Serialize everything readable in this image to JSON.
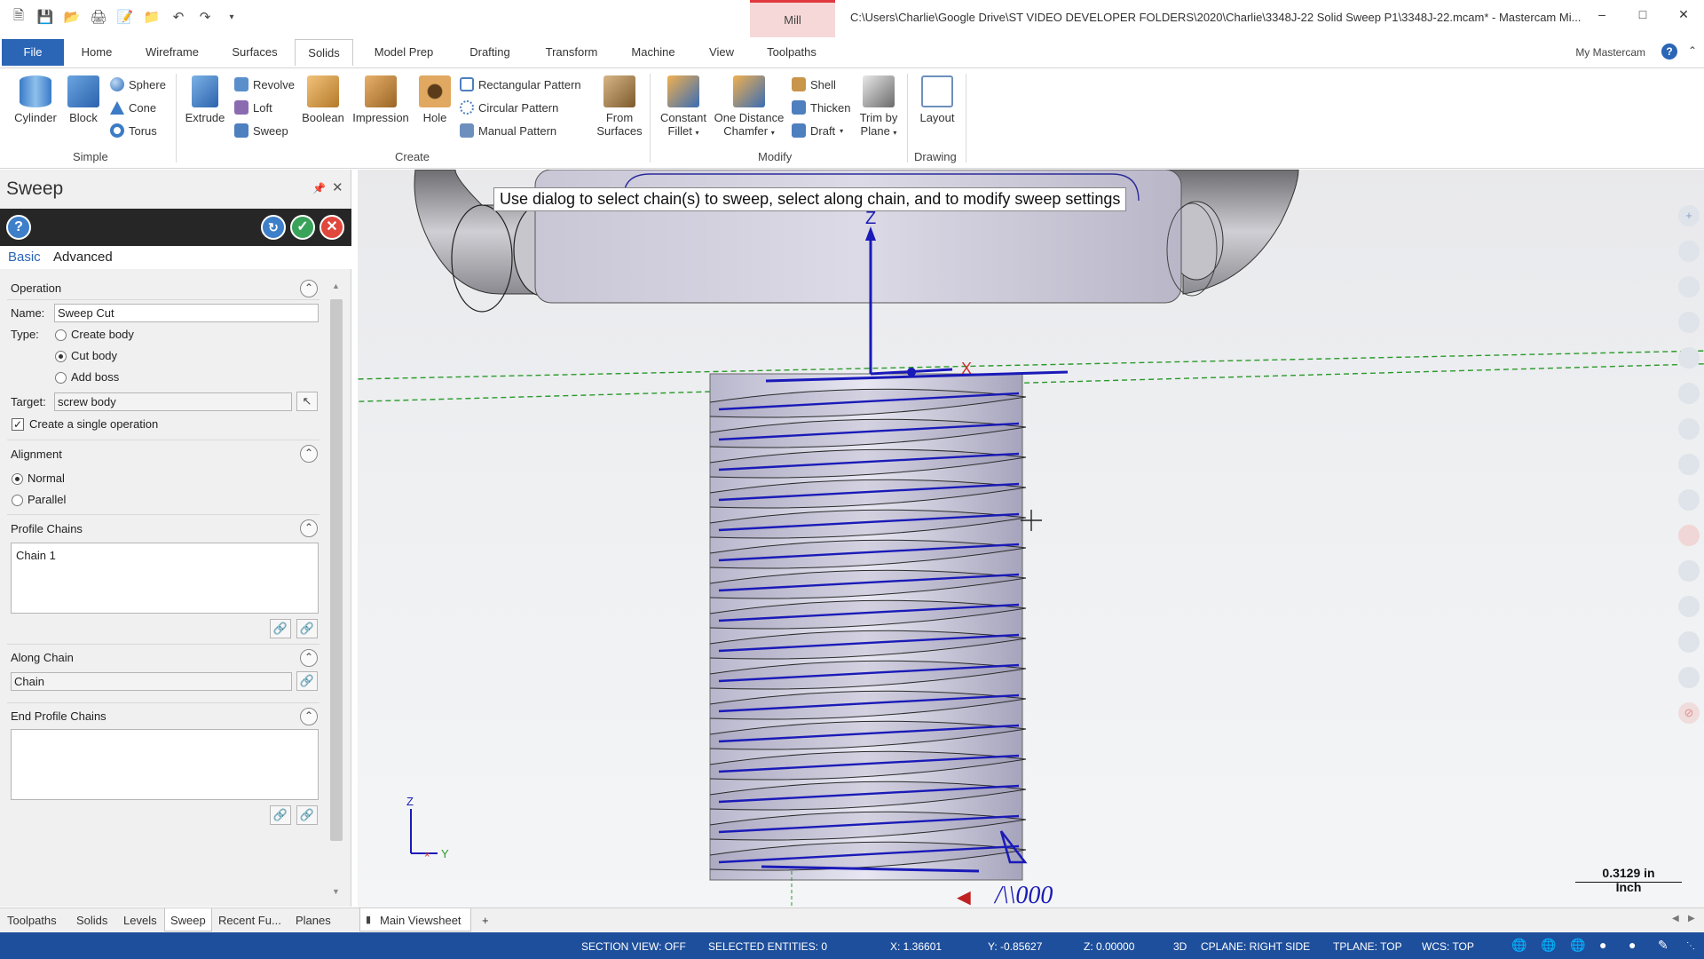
{
  "app": {
    "title": "C:\\Users\\Charlie\\Google Drive\\ST VIDEO DEVELOPER FOLDERS\\2020\\Charlie\\3348J-22 Solid Sweep P1\\3348J-22.mcam* - Mastercam Mi...",
    "context_tab": "Mill",
    "my_mastercam": "My Mastercam"
  },
  "ribbon_tabs": [
    "File",
    "Home",
    "Wireframe",
    "Surfaces",
    "Solids",
    "Model Prep",
    "Drafting",
    "Transform",
    "Machine",
    "View",
    "Toolpaths"
  ],
  "ribbon": {
    "simple": {
      "label": "Simple",
      "cylinder": "Cylinder",
      "block": "Block",
      "sphere": "Sphere",
      "cone": "Cone",
      "torus": "Torus"
    },
    "create": {
      "label": "Create",
      "extrude": "Extrude",
      "revolve": "Revolve",
      "loft": "Loft",
      "sweep": "Sweep",
      "boolean": "Boolean",
      "impression": "Impression",
      "hole": "Hole",
      "rect_pattern": "Rectangular Pattern",
      "circ_pattern": "Circular Pattern",
      "manual_pattern": "Manual Pattern",
      "from_surfaces_1": "From",
      "from_surfaces_2": "Surfaces"
    },
    "modify": {
      "label": "Modify",
      "const_fillet_1": "Constant",
      "const_fillet_2": "Fillet",
      "chamfer_1": "One Distance",
      "chamfer_2": "Chamfer",
      "shell": "Shell",
      "thicken": "Thicken",
      "draft": "Draft",
      "trim_1": "Trim by",
      "trim_2": "Plane"
    },
    "drawing": {
      "label": "Drawing",
      "layout": "Layout"
    }
  },
  "panel": {
    "title": "Sweep",
    "tabs": {
      "basic": "Basic",
      "advanced": "Advanced"
    },
    "operation": {
      "header": "Operation",
      "name_label": "Name:",
      "name_value": "Sweep Cut",
      "type_label": "Type:",
      "types": [
        "Create body",
        "Cut body",
        "Add boss"
      ],
      "selected_type": "Cut body",
      "target_label": "Target:",
      "target_value": "screw body",
      "single_op": "Create a single operation",
      "single_op_checked": true
    },
    "alignment": {
      "header": "Alignment",
      "options": [
        "Normal",
        "Parallel"
      ],
      "selected": "Normal"
    },
    "profile_chains": {
      "header": "Profile Chains",
      "items": [
        "Chain  1"
      ]
    },
    "along_chain": {
      "header": "Along Chain",
      "value": "Chain"
    },
    "end_profile_chains": {
      "header": "End Profile Chains"
    }
  },
  "bottom_tabs": [
    "Toolpaths",
    "Solids",
    "Levels",
    "Sweep",
    "Recent Fu...",
    "Planes"
  ],
  "viewsheet": {
    "label": "Main Viewsheet",
    "add": "+"
  },
  "viewport": {
    "prompt": "Use dialog to select chain(s) to sweep, select along chain, and to modify sweep settings",
    "scale_value": "0.3129 in",
    "scale_unit": "Inch",
    "axis_labels": {
      "z": "Z",
      "x": "X",
      "y": "Y"
    }
  },
  "statusbar": {
    "section_view": "SECTION VIEW: OFF",
    "selected": "SELECTED ENTITIES: 0",
    "x": "X:  1.36601",
    "y": "Y:  -0.85627",
    "z": "Z:  0.00000",
    "mode": "3D",
    "cplane": "CPLANE: RIGHT SIDE",
    "tplane": "TPLANE: TOP",
    "wcs": "WCS: TOP"
  },
  "colors": {
    "accent": "#2a65b6",
    "status": "#1e4f9c",
    "mill_tab": "#e0383e",
    "chain_blue": "#1a1ab8"
  }
}
